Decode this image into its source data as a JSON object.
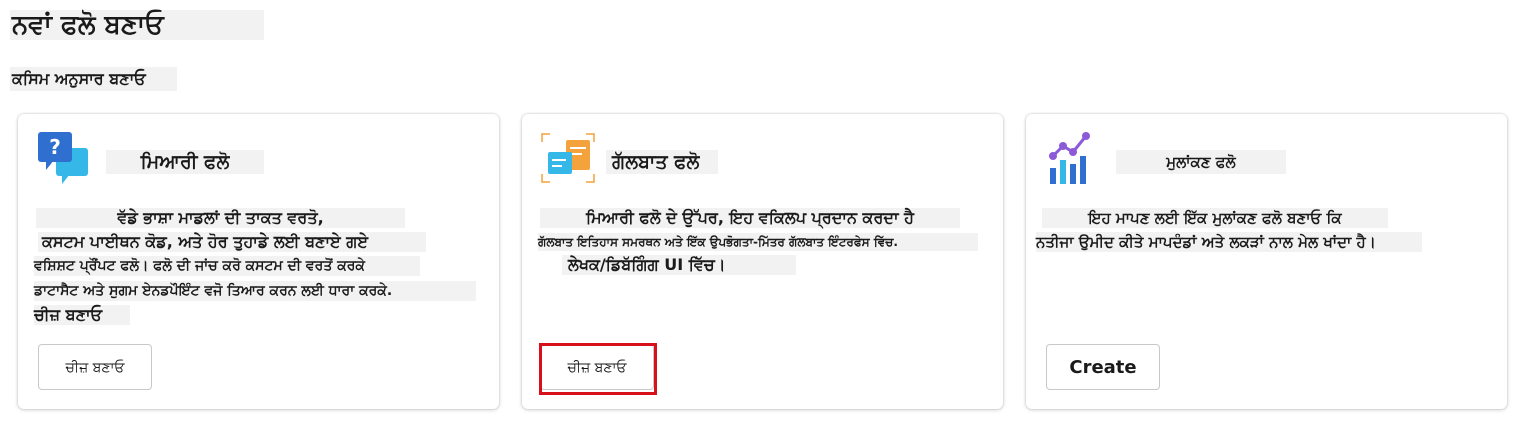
{
  "header": {
    "title": "ਨਵਾਂ ਫਲੋ ਬਣਾਓ",
    "subtitle": "ਕਸਿਮ ਅਨੁਸਾਰ ਬਣਾਓ"
  },
  "cards": [
    {
      "title": "ਮਿਆਰੀ ਫਲੋ",
      "icon": "chat-question-icon",
      "description": [
        "ਵੱਡੇ ਭਾਸ਼ਾ ਮਾਡਲਾਂ ਦੀ ਤਾਕਤ ਵਰਤੋ,",
        "ਕਸਟਮ ਪਾਈਥਨ ਕੋਡ, ਅਤੇ ਹੋਰ ਤੁਹਾਡੇ ਲਈ ਬਣਾਏ ਗਏ",
        "ਵਸ਼ਿਸ਼ਟ ਪ੍ਰੌਂਪਟ ਫਲੋ। ਫਲੋ ਦੀ ਜਾਂਚ ਕਰੋ ਕਸਟਮ ਦੀ ਵਰਤੋਂ ਕਰਕੇ",
        "ਡਾਟਾਸੈਟ ਅਤੇ ਸੁਗਮ ਏਨਡਪੌਇੰਟ ਵਜੋ ਤਿਆਰ ਕਰਨ ਲਈ ਧਾਰਾ ਕਰਕੇ.",
        "ਚੀਜ਼ ਬਣਾਓ"
      ],
      "button": "ਚੀਜ਼ ਬਣਾਓ"
    },
    {
      "title": "ਗੱਲਬਾਤ ਫਲੋ",
      "icon": "chat-flow-icon",
      "description": [
        "ਮਿਆਰੀ ਫਲੋ ਦੇ ਉੱਪਰ, ਇਹ ਵਕਿਲਪ ਪ੍ਰਦਾਨ ਕਰਦਾ ਹੈ",
        "ਗੱਲਬਾਤ ਇਤਿਹਾਸ ਸਮਰਥਨ ਅਤੇ ਇੱਕ ਉਪਭੋਗਤਾ-ਮਿੱਤਰ ਗੱਲਬਾਤ ਇੰਟਰਫੇਸ ਵਿੱਚ.",
        "ਲੇਖਕ/ਡਿਬੱਗਿੰਗ UI ਵਿੱਚ।"
      ],
      "button": "ਚੀਜ਼ ਬਣਾਓ"
    },
    {
      "title": "ਮੁਲਾਂਕਣ ਫਲੋ",
      "icon": "evaluation-chart-icon",
      "description": [
        "ਇਹ ਮਾਪਣ ਲਈ ਇੱਕ ਮੁਲਾਂਕਣ ਫਲੋ ਬਣਾਓ ਕਿ",
        "ਨਤੀਜਾ ਉਮੀਦ ਕੀਤੇ ਮਾਪਦੰਡਾਂ ਅਤੇ ਲਕੜਾਂ ਨਾਲ ਮੇਲ ਖਾਂਦਾ ਹੈ।"
      ],
      "button": "Create"
    }
  ],
  "colors": {
    "highlight": "#d8101a",
    "text_shade": "#f2f2f2",
    "icon_blue": "#2f6fd0",
    "icon_cyan": "#35b8e8",
    "icon_orange": "#f4a23c",
    "icon_purple": "#8c5ad8"
  }
}
